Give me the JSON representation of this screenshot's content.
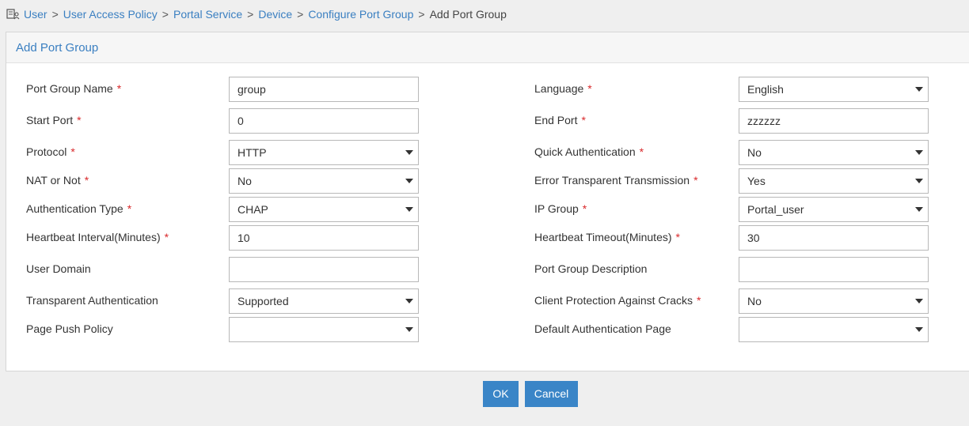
{
  "breadcrumb": {
    "items": [
      "User",
      "User Access Policy",
      "Portal Service",
      "Device",
      "Configure Port Group"
    ],
    "current": "Add Port Group",
    "separator": ">"
  },
  "panel": {
    "title": "Add Port Group"
  },
  "required_mark": "*",
  "form": {
    "left": [
      {
        "label": "Port Group Name",
        "required": true,
        "type": "text",
        "value": "group"
      },
      {
        "label": "Start Port",
        "required": true,
        "type": "text",
        "value": "0"
      },
      {
        "label": "Protocol",
        "required": true,
        "type": "select",
        "value": "HTTP"
      },
      {
        "label": "NAT or Not",
        "required": true,
        "type": "select",
        "value": "No"
      },
      {
        "label": "Authentication Type",
        "required": true,
        "type": "select",
        "value": "CHAP"
      },
      {
        "label": "Heartbeat Interval(Minutes)",
        "required": true,
        "type": "text",
        "value": "10"
      },
      {
        "label": "User Domain",
        "required": false,
        "type": "text",
        "value": ""
      },
      {
        "label": "Transparent Authentication",
        "required": false,
        "type": "select",
        "value": "Supported"
      },
      {
        "label": "Page Push Policy",
        "required": false,
        "type": "select",
        "value": ""
      }
    ],
    "right": [
      {
        "label": "Language",
        "required": true,
        "type": "select",
        "value": "English"
      },
      {
        "label": "End Port",
        "required": true,
        "type": "text",
        "value": "zzzzzz"
      },
      {
        "label": "Quick Authentication",
        "required": true,
        "type": "select",
        "value": "No"
      },
      {
        "label": "Error Transparent Transmission",
        "required": true,
        "type": "select",
        "value": "Yes"
      },
      {
        "label": "IP Group",
        "required": true,
        "type": "select",
        "value": "Portal_user"
      },
      {
        "label": "Heartbeat Timeout(Minutes)",
        "required": true,
        "type": "text",
        "value": "30"
      },
      {
        "label": "Port Group Description",
        "required": false,
        "type": "text",
        "value": ""
      },
      {
        "label": "Client Protection Against Cracks",
        "required": true,
        "type": "select",
        "value": "No"
      },
      {
        "label": "Default Authentication Page",
        "required": false,
        "type": "select",
        "value": ""
      }
    ]
  },
  "buttons": {
    "ok": "OK",
    "cancel": "Cancel"
  },
  "colors": {
    "link": "#3a7fc1",
    "required": "#d9292b",
    "button": "#3a85c7"
  }
}
